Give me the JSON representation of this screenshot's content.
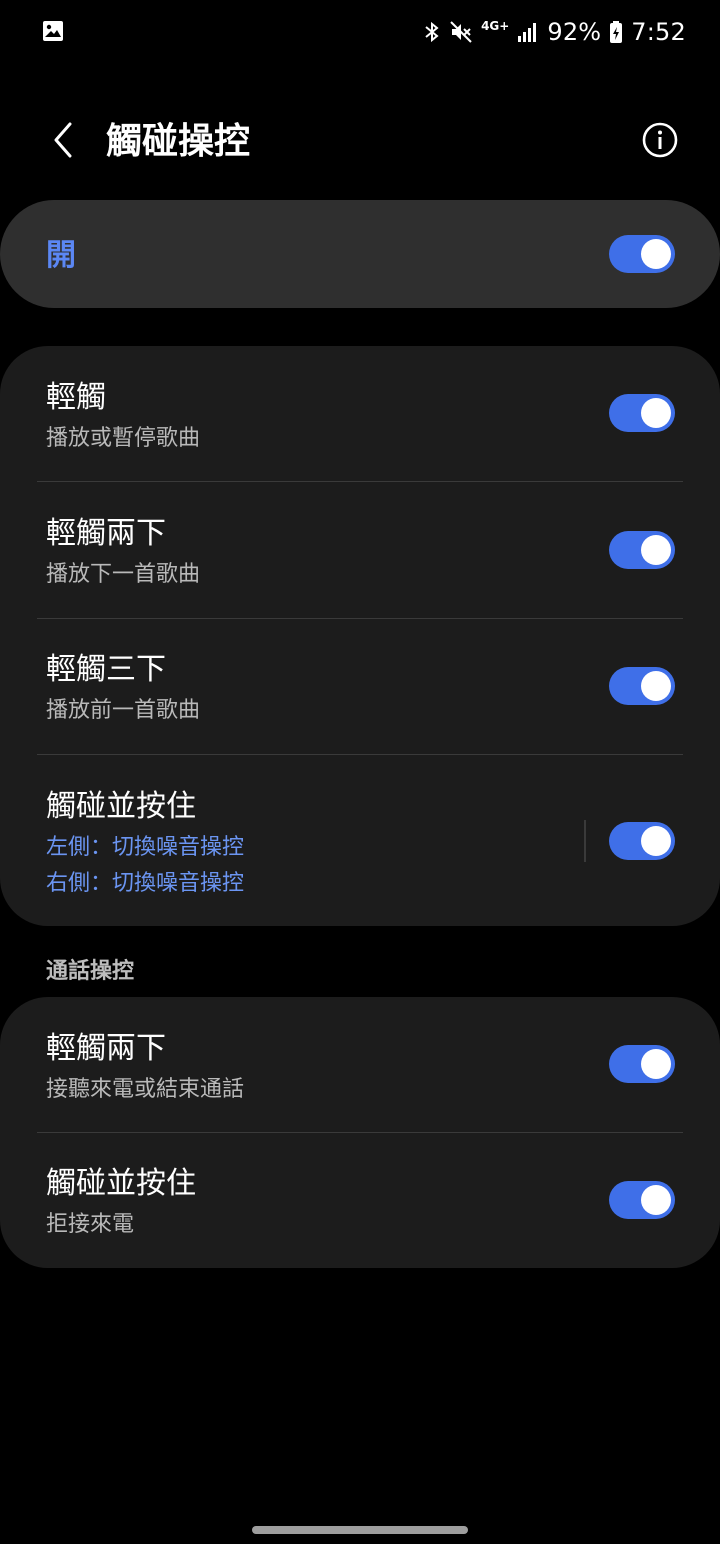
{
  "status_bar": {
    "network": "4G+",
    "battery": "92%",
    "time": "7:52"
  },
  "header": {
    "title": "觸碰操控"
  },
  "master": {
    "label": "開",
    "on": true
  },
  "controls": [
    {
      "title": "輕觸",
      "subtitle": "播放或暫停歌曲",
      "on": true
    },
    {
      "title": "輕觸兩下",
      "subtitle": "播放下一首歌曲",
      "on": true
    },
    {
      "title": "輕觸三下",
      "subtitle": "播放前一首歌曲",
      "on": true
    },
    {
      "title": "觸碰並按住",
      "subtitle_left": "左側：切換噪音操控",
      "subtitle_right": "右側：切換噪音操控",
      "on": true
    }
  ],
  "call_section": {
    "header": "通話操控",
    "items": [
      {
        "title": "輕觸兩下",
        "subtitle": "接聽來電或結束通話",
        "on": true
      },
      {
        "title": "觸碰並按住",
        "subtitle": "拒接來電",
        "on": true
      }
    ]
  },
  "colors": {
    "accent": "#3f6fe8",
    "accent_text": "#5b87f4",
    "card": "#1c1c1c",
    "master_card": "#2f2f2f"
  }
}
